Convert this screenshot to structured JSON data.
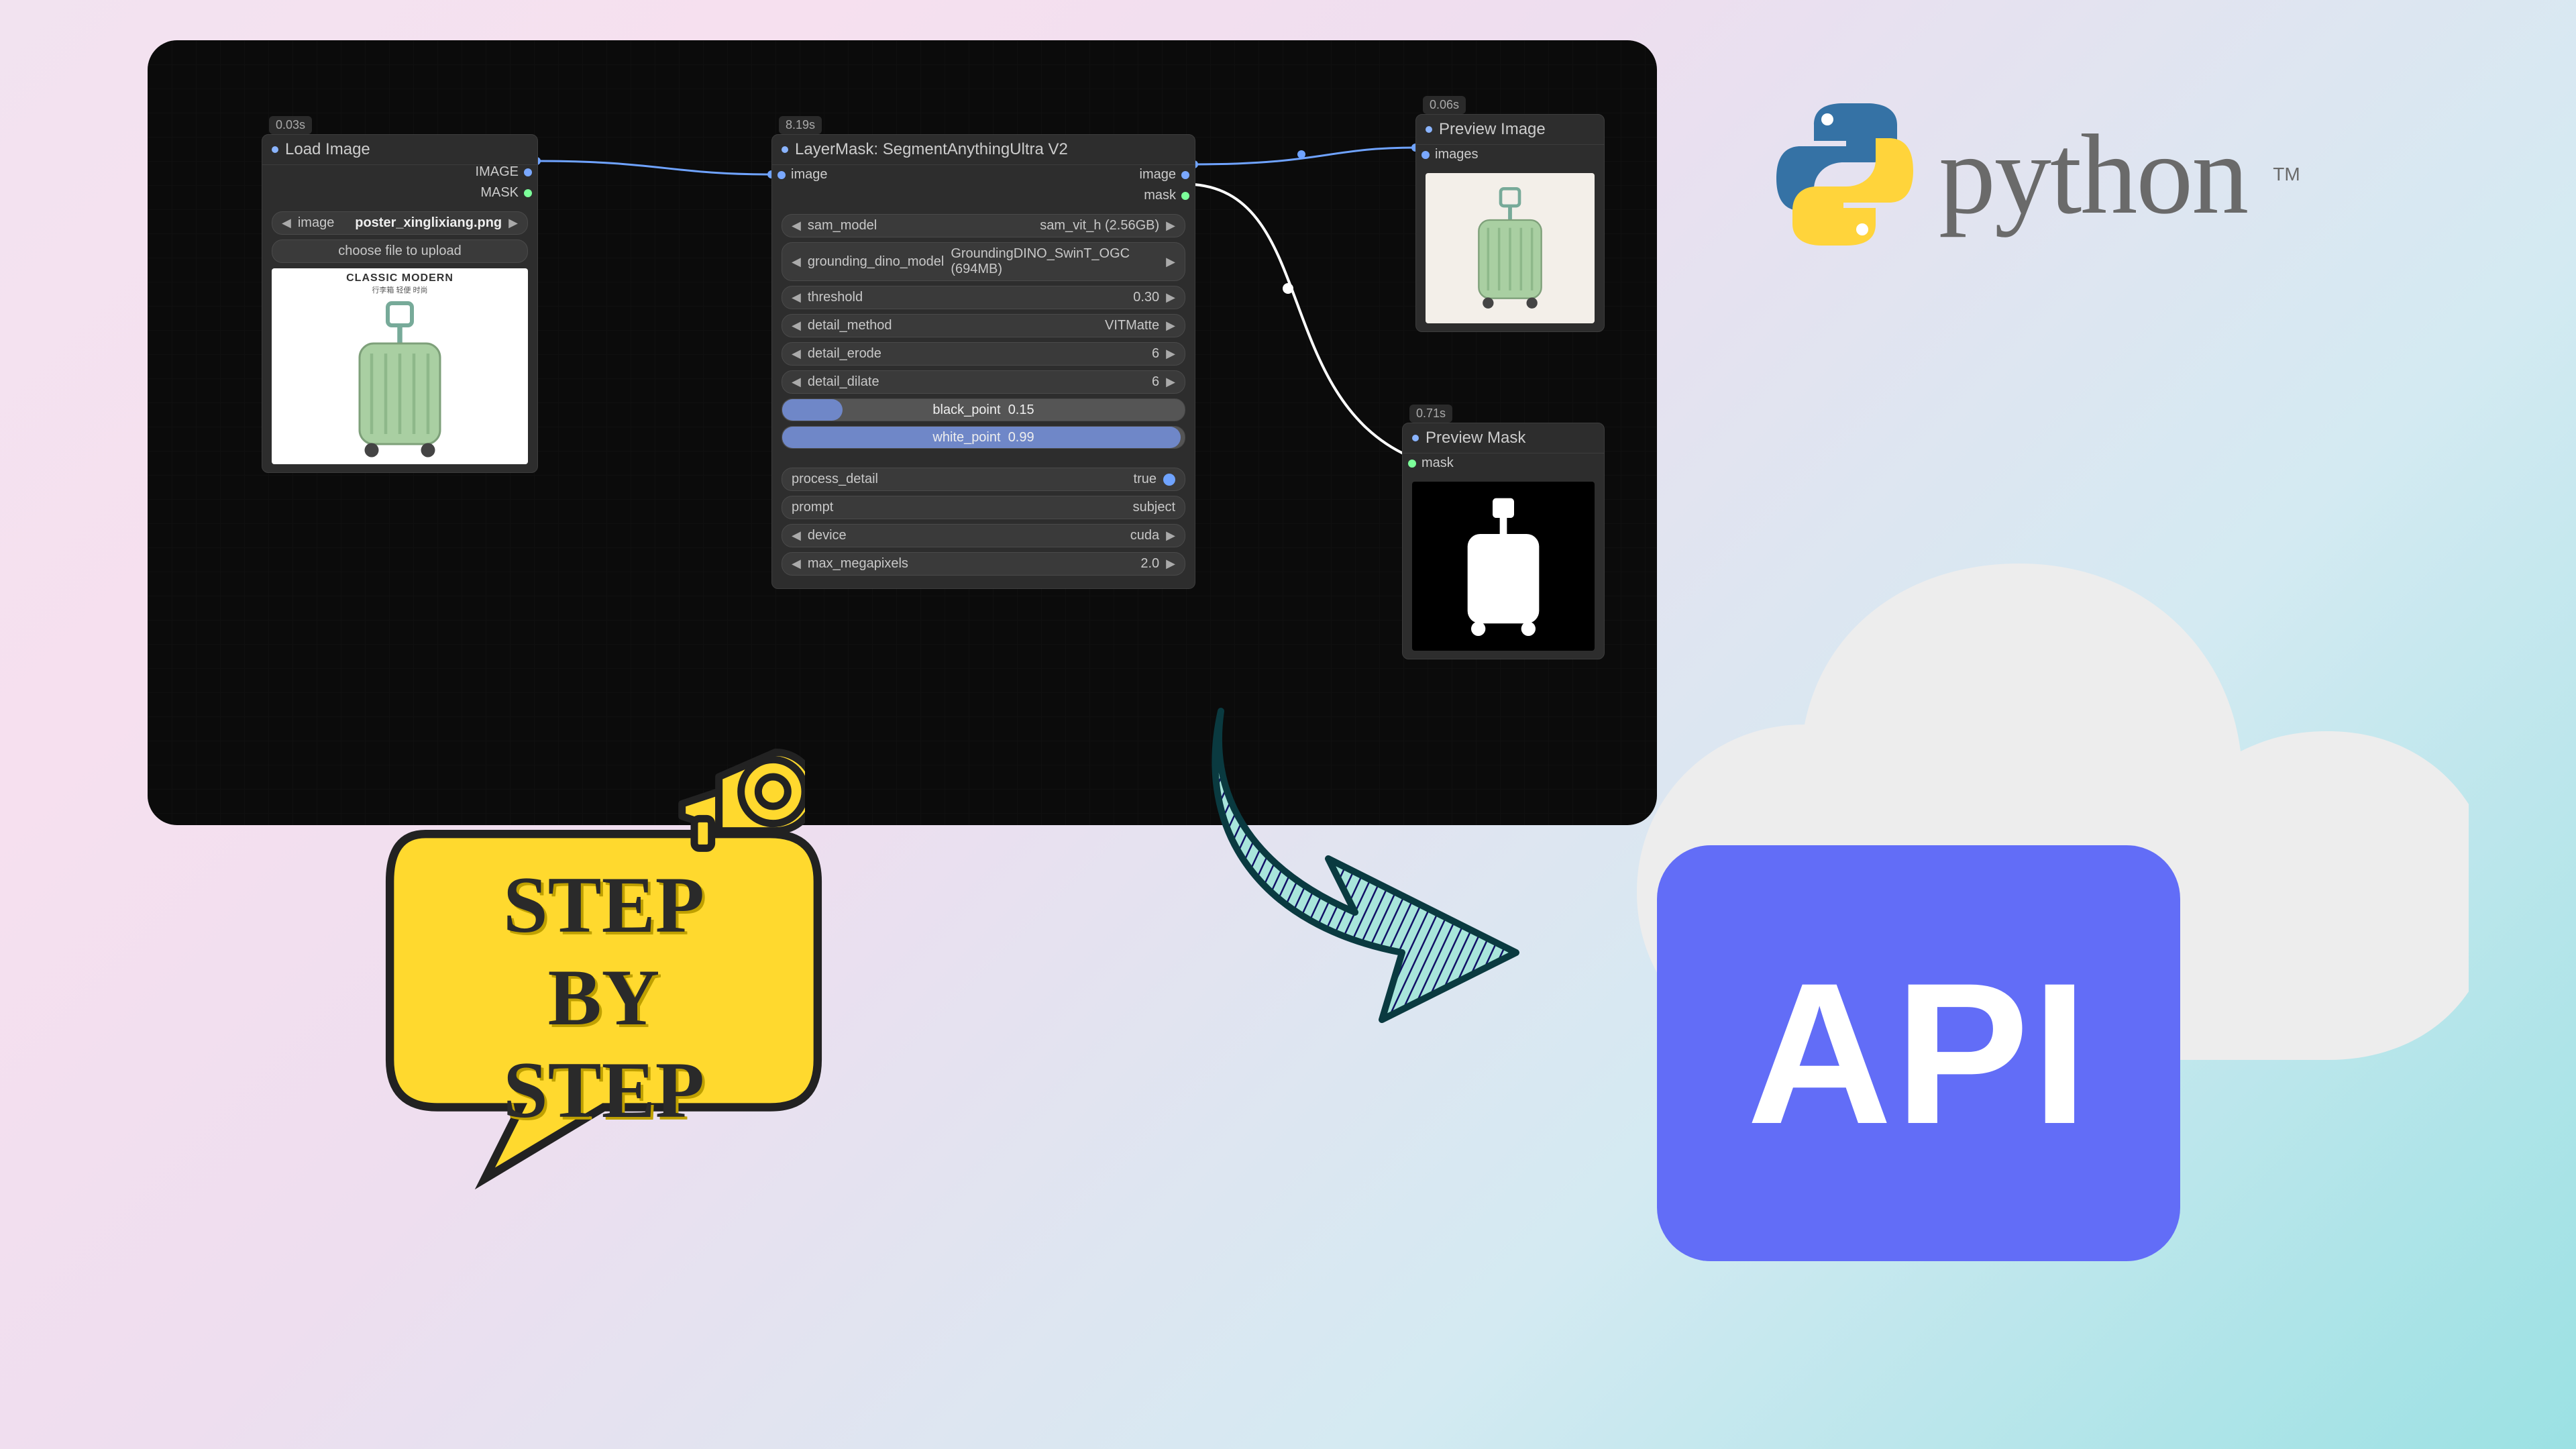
{
  "python_label": "python",
  "python_tm": "TM",
  "api_label": "API",
  "step": {
    "line1": "STEP",
    "line2": "BY",
    "line3": "STEP"
  },
  "nodes": {
    "load": {
      "time": "0.03s",
      "title": "Load Image",
      "out_image": "IMAGE",
      "out_mask": "MASK",
      "field_image_label": "image",
      "field_image_value": "poster_xinglixiang.png",
      "upload_btn": "choose file to upload",
      "caption1": "CLASSIC MODERN",
      "caption2": "行李箱 轻便 时尚"
    },
    "sam": {
      "time": "8.19s",
      "title": "LayerMask: SegmentAnythingUltra V2",
      "in_image": "image",
      "out_image": "image",
      "out_mask": "mask",
      "rows": {
        "sam_model": {
          "label": "sam_model",
          "value": "sam_vit_h (2.56GB)"
        },
        "dino": {
          "label": "grounding_dino_model",
          "value": "GroundingDINO_SwinT_OGC (694MB)"
        },
        "threshold": {
          "label": "threshold",
          "value": "0.30"
        },
        "detail_method": {
          "label": "detail_method",
          "value": "VITMatte"
        },
        "detail_erode": {
          "label": "detail_erode",
          "value": "6"
        },
        "detail_dilate": {
          "label": "detail_dilate",
          "value": "6"
        }
      },
      "black_point": {
        "label": "black_point",
        "value": "0.15",
        "pct": 15
      },
      "white_point": {
        "label": "white_point",
        "value": "0.99",
        "pct": 99
      },
      "process_detail": {
        "label": "process_detail",
        "value": "true"
      },
      "prompt": {
        "label": "prompt",
        "value": "subject"
      },
      "device": {
        "label": "device",
        "value": "cuda"
      },
      "max_mp": {
        "label": "max_megapixels",
        "value": "2.0"
      }
    },
    "preview_img": {
      "time": "0.06s",
      "title": "Preview Image",
      "in_images": "images"
    },
    "preview_mask": {
      "time": "0.71s",
      "title": "Preview Mask",
      "in_mask": "mask"
    }
  }
}
